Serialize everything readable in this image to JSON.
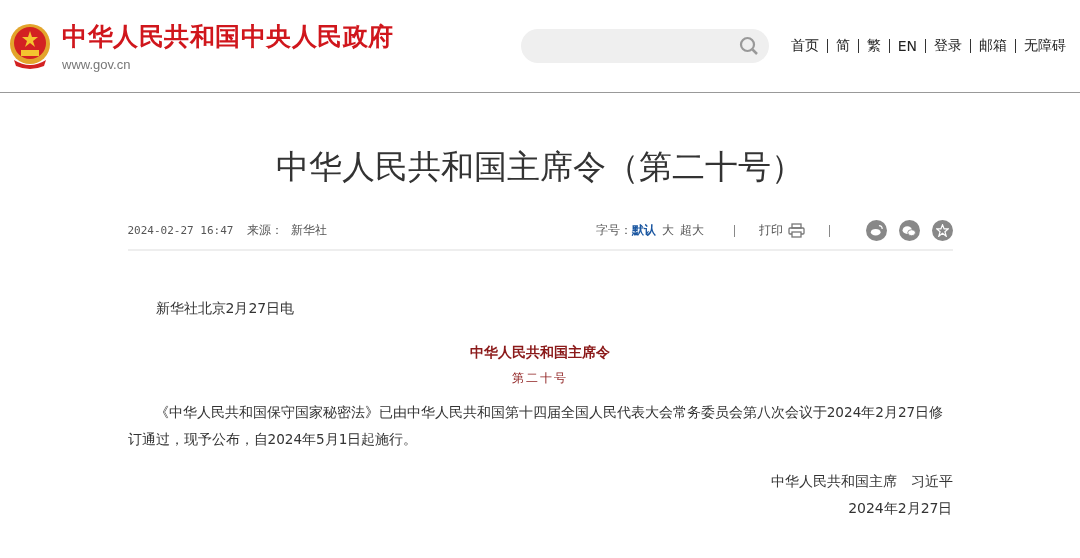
{
  "header": {
    "site_name": "中华人民共和国中央人民政府",
    "domain": "www.gov.cn",
    "nav": [
      "首页",
      "简",
      "繁",
      "EN",
      "登录",
      "邮箱",
      "无障碍"
    ]
  },
  "article": {
    "title": "中华人民共和国主席令（第二十号）",
    "date": "2024-02-27 16:47",
    "source_label": "来源：",
    "source": "新华社",
    "font_size_label": "字号：",
    "font_sizes": [
      {
        "label": "默认",
        "selected": true
      },
      {
        "label": "大",
        "selected": false
      },
      {
        "label": "超大",
        "selected": false
      }
    ],
    "print_label": "打印",
    "share": [
      {
        "kind": "weibo"
      },
      {
        "kind": "wechat"
      },
      {
        "kind": "favorite"
      }
    ],
    "dateline": "新华社北京2月27日电",
    "order_title": "中华人民共和国主席令",
    "order_number": "第二十号",
    "body": "《中华人民共和国保守国家秘密法》已由中华人民共和国第十四届全国人民代表大会常务委员会第八次会议于2024年2月27日修订通过，现予公布，自2024年5月1日起施行。",
    "signature": "中华人民共和国主席　习近平",
    "sign_date": "2024年2月27日"
  }
}
